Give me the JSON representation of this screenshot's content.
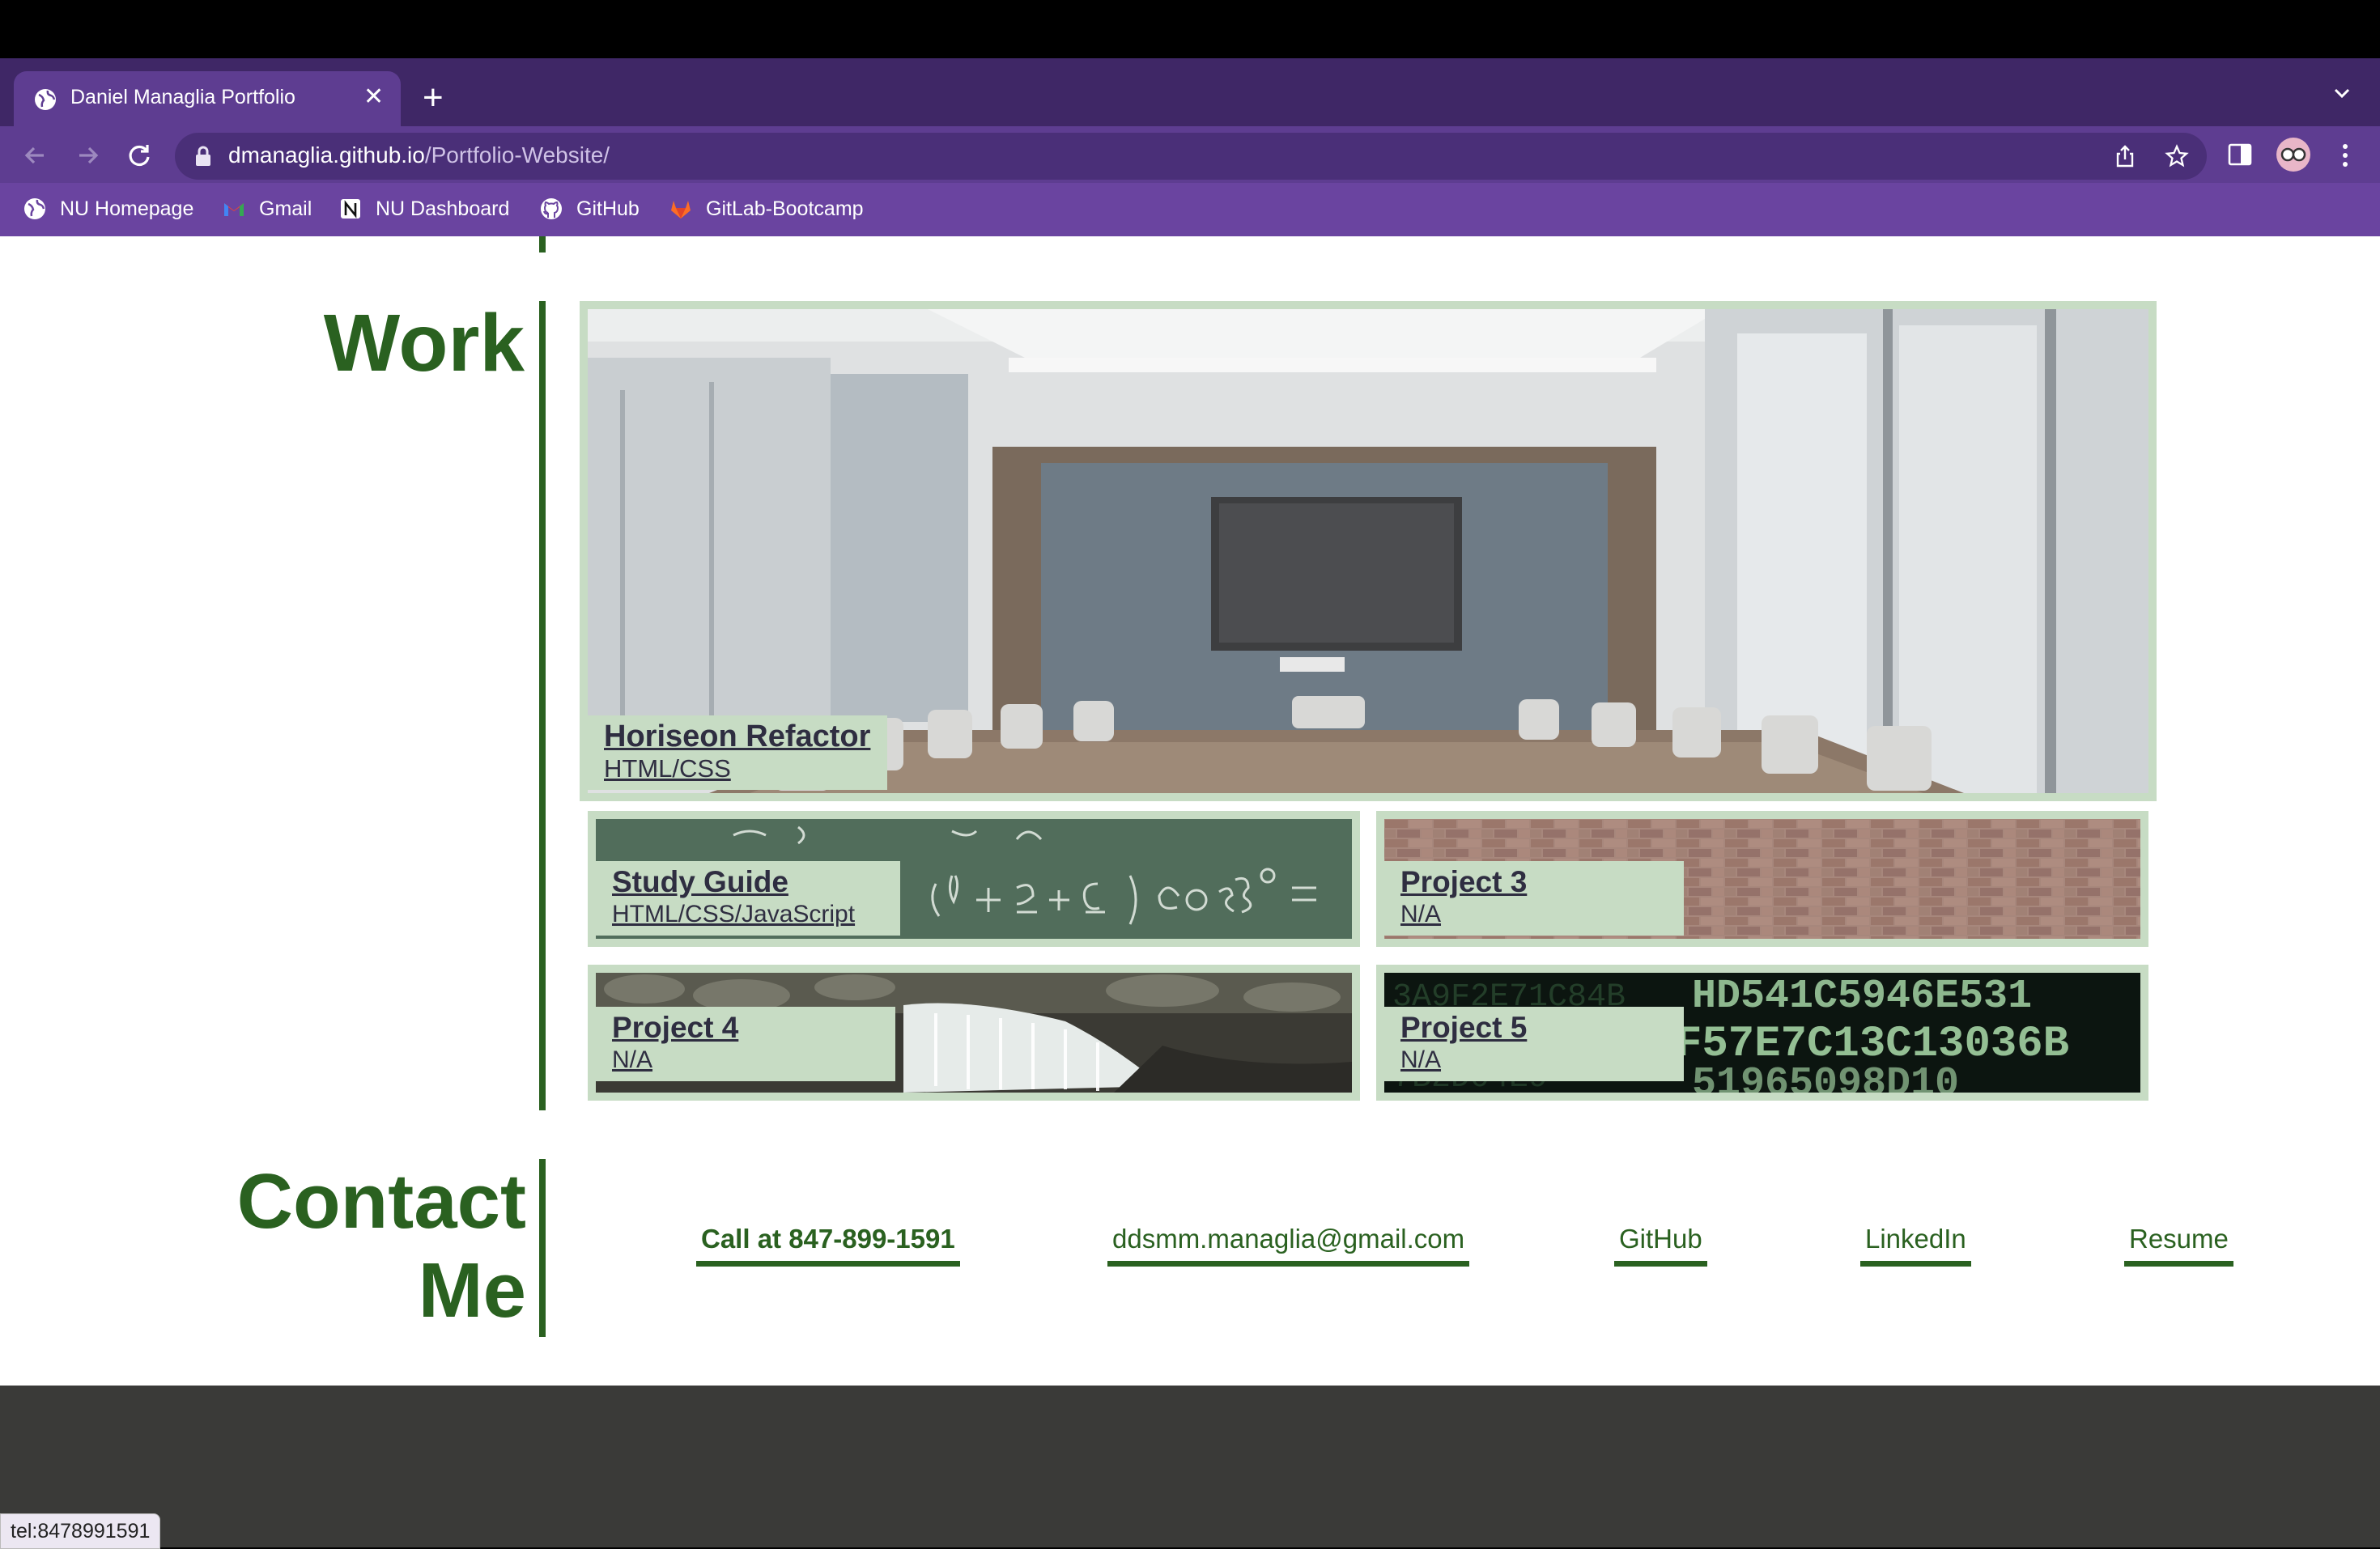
{
  "browser": {
    "tab_title": "Daniel Managlia Portfolio",
    "url_host": "dmanaglia.github.io",
    "url_path": "/Portfolio-Website/",
    "bookmarks": [
      {
        "label": "NU Homepage",
        "icon": "globe-icon"
      },
      {
        "label": "Gmail",
        "icon": "gmail-icon"
      },
      {
        "label": "NU Dashboard",
        "icon": "notion-icon"
      },
      {
        "label": "GitHub",
        "icon": "github-icon"
      },
      {
        "label": "GitLab-Bootcamp",
        "icon": "gitlab-icon"
      }
    ],
    "status_url": "tel:8478991591"
  },
  "work": {
    "heading": "Work",
    "projects": [
      {
        "name": "Horiseon Refactor",
        "tech": "HTML/CSS"
      },
      {
        "name": "Study Guide",
        "tech": "HTML/CSS/JavaScript"
      },
      {
        "name": "Project 3",
        "tech": "N/A"
      },
      {
        "name": "Project 4",
        "tech": "N/A"
      },
      {
        "name": "Project 5",
        "tech": "N/A"
      }
    ]
  },
  "contact": {
    "heading_line1": "Contact",
    "heading_line2": "Me",
    "links": [
      {
        "label": "Call at 847-899-1591"
      },
      {
        "label": "ddsmm.managlia@gmail.com"
      },
      {
        "label": "GitHub"
      },
      {
        "label": "LinkedIn"
      },
      {
        "label": "Resume"
      }
    ]
  },
  "colors": {
    "accent_green": "#2a6120",
    "card_green": "#c7dcc4",
    "chrome_purple": "#5e3d91",
    "footer": "#3a3a38"
  }
}
